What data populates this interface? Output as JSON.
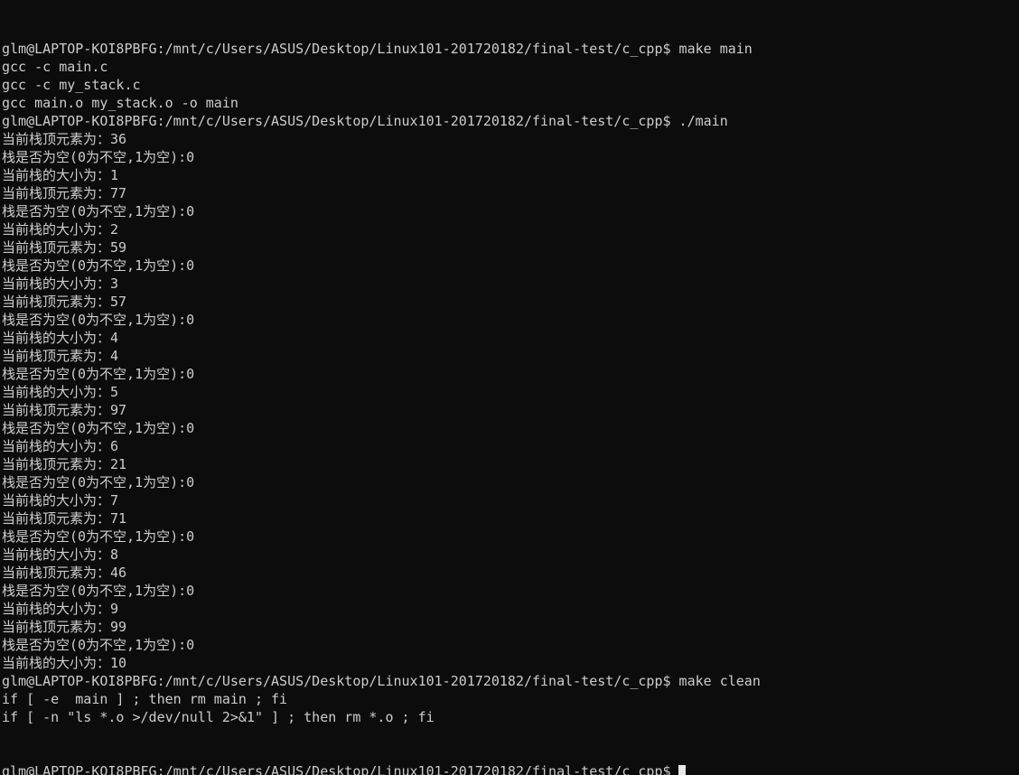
{
  "terminal": {
    "window_title": "glm@LAPTOP-KOI8PBFG: /mnt/c/Users/ASUS/Desktop/Linux101-201720182/final-test/c_cpp",
    "colors": {
      "background": "#0c0c0c",
      "foreground": "#cccccc",
      "cursor": "#e8e8e8"
    },
    "user": "glm",
    "host": "LAPTOP-KOI8PBFG",
    "cwd": "/mnt/c/Users/ASUS/Desktop/Linux101-201720182/final-test/c_cpp",
    "prompt": "glm@LAPTOP-KOI8PBFG:/mnt/c/Users/ASUS/Desktop/Linux101-201720182/final-test/c_cpp$",
    "cursor_visible": true,
    "commands": [
      "make main",
      "./main",
      "make clean"
    ],
    "lines": [
      "glm@LAPTOP-KOI8PBFG:/mnt/c/Users/ASUS/Desktop/Linux101-201720182/final-test/c_cpp$ make main",
      "gcc -c main.c",
      "gcc -c my_stack.c",
      "gcc main.o my_stack.o -o main",
      "glm@LAPTOP-KOI8PBFG:/mnt/c/Users/ASUS/Desktop/Linux101-201720182/final-test/c_cpp$ ./main",
      "当前栈顶元素为：36",
      "栈是否为空(0为不空,1为空):0",
      "当前栈的大小为：1",
      "当前栈顶元素为：77",
      "栈是否为空(0为不空,1为空):0",
      "当前栈的大小为：2",
      "当前栈顶元素为：59",
      "栈是否为空(0为不空,1为空):0",
      "当前栈的大小为：3",
      "当前栈顶元素为：57",
      "栈是否为空(0为不空,1为空):0",
      "当前栈的大小为：4",
      "当前栈顶元素为：4",
      "栈是否为空(0为不空,1为空):0",
      "当前栈的大小为：5",
      "当前栈顶元素为：97",
      "栈是否为空(0为不空,1为空):0",
      "当前栈的大小为：6",
      "当前栈顶元素为：21",
      "栈是否为空(0为不空,1为空):0",
      "当前栈的大小为：7",
      "当前栈顶元素为：71",
      "栈是否为空(0为不空,1为空):0",
      "当前栈的大小为：8",
      "当前栈顶元素为：46",
      "栈是否为空(0为不空,1为空):0",
      "当前栈的大小为：9",
      "当前栈顶元素为：99",
      "栈是否为空(0为不空,1为空):0",
      "当前栈的大小为：10",
      "glm@LAPTOP-KOI8PBFG:/mnt/c/Users/ASUS/Desktop/Linux101-201720182/final-test/c_cpp$ make clean",
      "if [ -e  main ] ; then rm main ; fi",
      "if [ -n \"ls *.o >/dev/null 2>&1\" ] ; then rm *.o ; fi"
    ],
    "last_prompt": "glm@LAPTOP-KOI8PBFG:/mnt/c/Users/ASUS/Desktop/Linux101-201720182/final-test/c_cpp$",
    "stack_trace": {
      "top_label": "当前栈顶元素为：",
      "empty_label": "栈是否为空(0为不空,1为空):",
      "size_label": "当前栈的大小为：",
      "pushed_values": [
        36,
        77,
        59,
        57,
        4,
        97,
        21,
        71,
        46,
        99
      ],
      "is_empty_values": [
        0,
        0,
        0,
        0,
        0,
        0,
        0,
        0,
        0,
        0
      ],
      "sizes": [
        1,
        2,
        3,
        4,
        5,
        6,
        7,
        8,
        9,
        10
      ]
    },
    "build_output": [
      "gcc -c main.c",
      "gcc -c my_stack.c",
      "gcc main.o my_stack.o -o main"
    ],
    "clean_output": [
      "if [ -e  main ] ; then rm main ; fi",
      "if [ -n \"ls *.o >/dev/null 2>&1\" ] ; then rm *.o ; fi"
    ]
  }
}
